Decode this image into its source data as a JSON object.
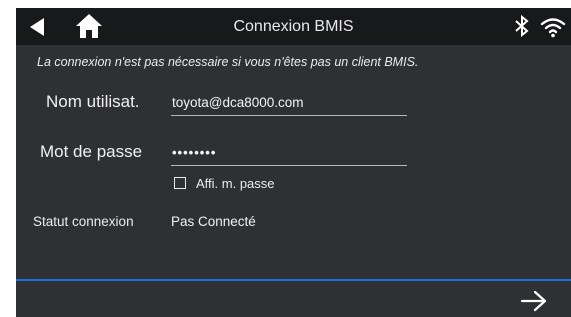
{
  "header": {
    "title": "Connexion BMIS",
    "back_icon": "back-arrow-icon",
    "home_icon": "home-icon",
    "bluetooth_icon": "bluetooth-icon",
    "wifi_icon": "wifi-icon"
  },
  "form": {
    "notice": "La connexion n'est pas nécessaire si vous n'êtes pas un client BMIS.",
    "username_label": "Nom utilisat.",
    "username_value": "toyota@dca8000.com",
    "password_label": "Mot de passe",
    "password_value": "••••••••",
    "show_password_label": "Affi. m. passe",
    "show_password_checked": false,
    "status_label": "Statut connexion",
    "status_value": "Pas Connecté"
  },
  "footer": {
    "next_icon": "arrow-right-icon"
  },
  "colors": {
    "background": "#2e3033",
    "header": "#18191b",
    "accent_line": "#1a73d9",
    "text": "#f0f0f0"
  }
}
